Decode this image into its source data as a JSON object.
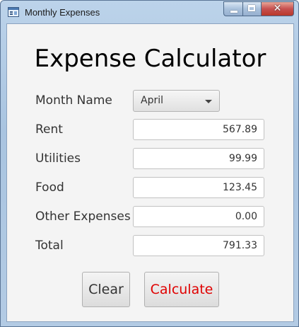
{
  "window": {
    "title": "Monthly Expenses"
  },
  "app": {
    "heading": "Expense Calculator",
    "month": {
      "label": "Month Name",
      "selected": "April"
    },
    "fields": [
      {
        "label": "Rent",
        "value": "567.89"
      },
      {
        "label": "Utilities",
        "value": "99.99"
      },
      {
        "label": "Food",
        "value": "123.45"
      },
      {
        "label": "Other Expenses",
        "value": "0.00"
      },
      {
        "label": "Total",
        "value": "791.33"
      }
    ],
    "buttons": {
      "clear": "Clear",
      "calculate": "Calculate"
    }
  },
  "colors": {
    "calculate_text": "#e00000",
    "titlebar": "#b3cbe4",
    "client_bg": "#f4f4f4"
  },
  "icons": {
    "app": "window-app-icon",
    "minimize": "minimize-icon",
    "maximize": "maximize-icon",
    "close": "close-icon",
    "dropdown": "chevron-down-icon"
  }
}
